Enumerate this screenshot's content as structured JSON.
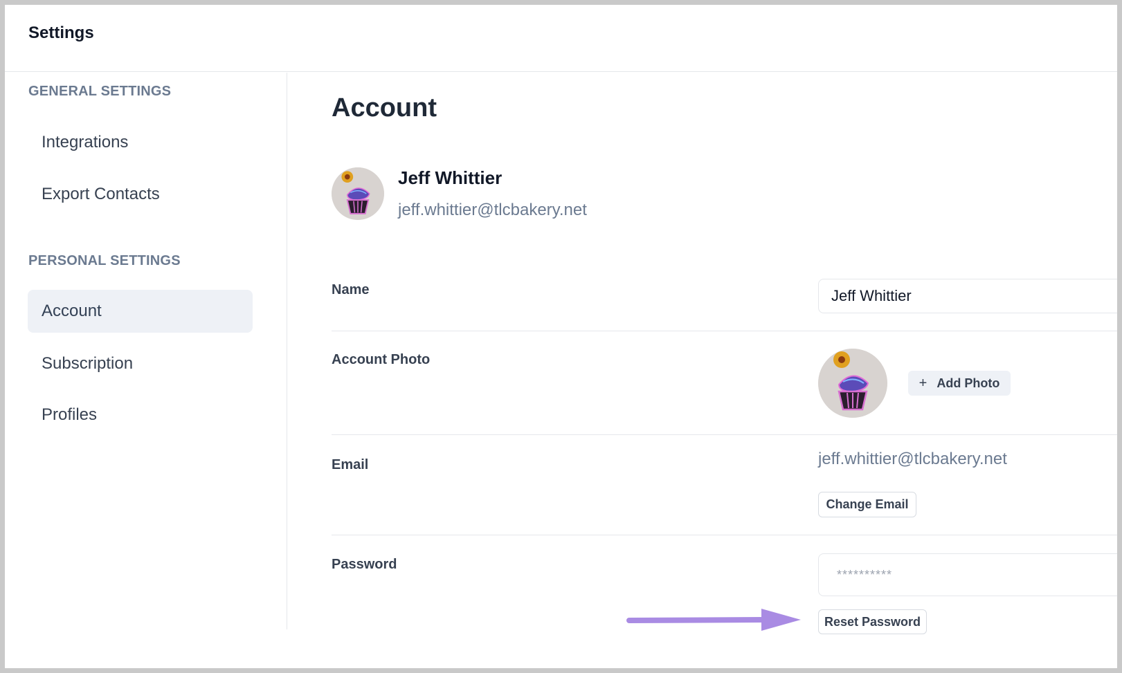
{
  "window": {
    "title": "Settings"
  },
  "sidebar": {
    "general_title": "GENERAL SETTINGS",
    "general_items": [
      {
        "label": "Integrations"
      },
      {
        "label": "Export Contacts"
      }
    ],
    "personal_title": "PERSONAL SETTINGS",
    "personal_items": [
      {
        "label": "Account",
        "active": true
      },
      {
        "label": "Subscription"
      },
      {
        "label": "Profiles"
      }
    ]
  },
  "main": {
    "page_title": "Account",
    "profile": {
      "name": "Jeff Whittier",
      "email": "jeff.whittier@tlcbakery.net",
      "avatar_icon": "cupcake-icon"
    },
    "name_row": {
      "label": "Name",
      "value": "Jeff Whittier"
    },
    "photo_row": {
      "label": "Account Photo",
      "add_button": "Add Photo",
      "add_icon": "plus-icon"
    },
    "email_row": {
      "label": "Email",
      "value": "jeff.whittier@tlcbakery.net",
      "change_button": "Change Email"
    },
    "password_row": {
      "label": "Password",
      "value": "**********",
      "reset_button": "Reset Password"
    }
  },
  "annotation": {
    "color": "#a98be3",
    "icon": "arrow-right-icon"
  }
}
